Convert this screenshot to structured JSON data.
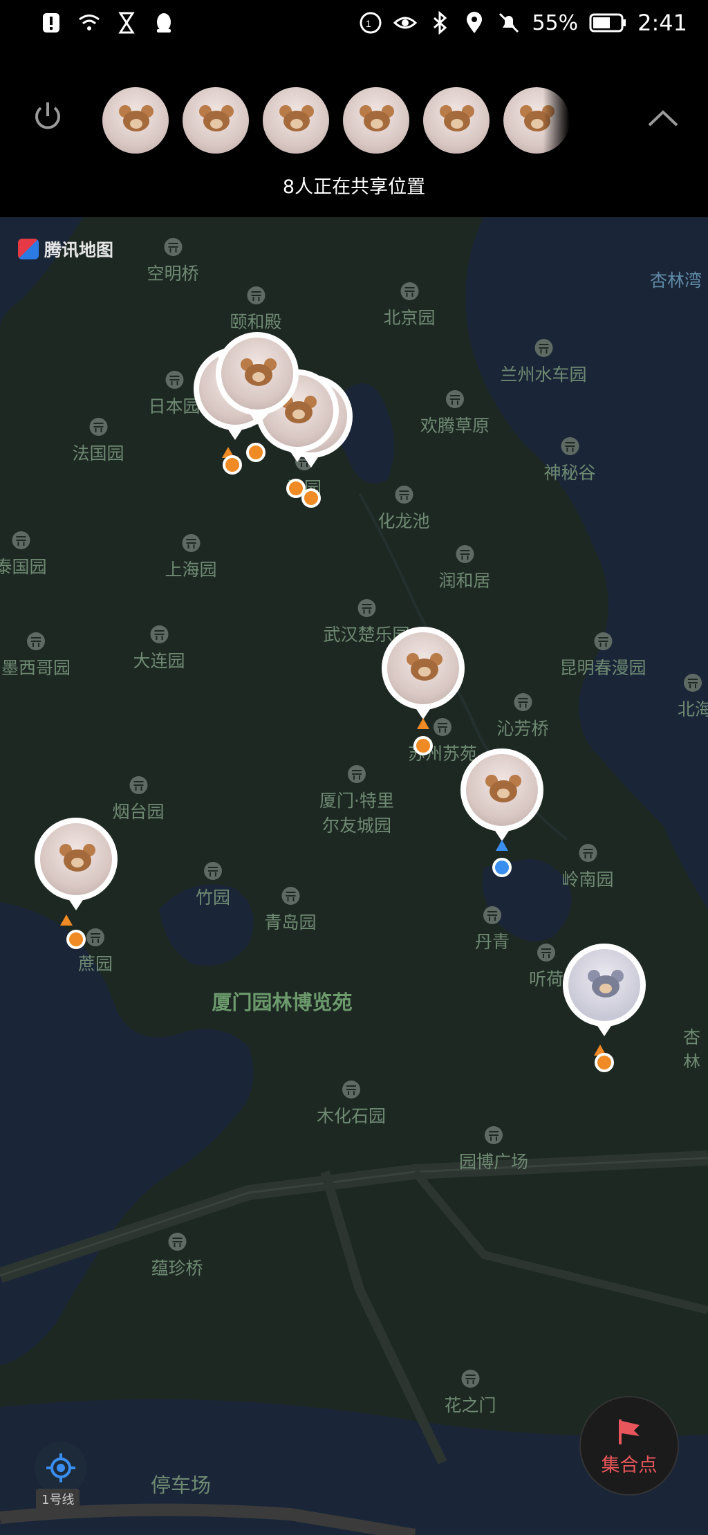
{
  "status_bar": {
    "battery": "55%",
    "time": "2:41"
  },
  "share": {
    "member_count_text": "8人正在共享位置",
    "avatars_count": 6
  },
  "map": {
    "provider": "腾讯地图",
    "area_name": "厦门园林博览苑",
    "pois": [
      {
        "key": "kongmingqiao",
        "label": "空明桥"
      },
      {
        "key": "yiheyuan",
        "label": "颐和殿"
      },
      {
        "key": "beijingyuan",
        "label": "北京园"
      },
      {
        "key": "lanzhou",
        "label": "兰州水车园"
      },
      {
        "key": "ribenyuan",
        "label": "日本园"
      },
      {
        "key": "huanteng",
        "label": "欢腾草原"
      },
      {
        "key": "faguoyuan",
        "label": "法国园"
      },
      {
        "key": "shenmigu",
        "label": "神秘谷"
      },
      {
        "key": "hanyuan",
        "label": "汉园"
      },
      {
        "key": "hualongchi",
        "label": "化龙池"
      },
      {
        "key": "taiguoyuan",
        "label": "泰国园"
      },
      {
        "key": "shanghaiyuan",
        "label": "上海园"
      },
      {
        "key": "runheju",
        "label": "润和居"
      },
      {
        "key": "wuhan",
        "label": "武汉楚乐园"
      },
      {
        "key": "mexico",
        "label": "墨西哥园"
      },
      {
        "key": "dalianyuan",
        "label": "大连园"
      },
      {
        "key": "kunming",
        "label": "昆明春漫园"
      },
      {
        "key": "beihai",
        "label": "北海北海·银滩情"
      },
      {
        "key": "qinfangqiao",
        "label": "沁芳桥"
      },
      {
        "key": "suzhouyuan",
        "label": "苏州苏苑"
      },
      {
        "key": "yantaiyuan",
        "label": "烟台园"
      },
      {
        "key": "xiamen_tl",
        "label": "厦门·特里尔友城园"
      },
      {
        "key": "lingnan",
        "label": "岭南园"
      },
      {
        "key": "zhuyuan",
        "label": "竹园"
      },
      {
        "key": "qingdao",
        "label": "青岛园"
      },
      {
        "key": "danqing",
        "label": "丹青"
      },
      {
        "key": "zheyuan",
        "label": "蔗园"
      },
      {
        "key": "tinghe",
        "label": "听荷"
      },
      {
        "key": "xinglin_sl",
        "label": "杏林水利"
      },
      {
        "key": "muhuashi",
        "label": "木化石园"
      },
      {
        "key": "yuanbo",
        "label": "园博广场"
      },
      {
        "key": "yunzhenqiao",
        "label": "蕴珍桥"
      },
      {
        "key": "huazhimen",
        "label": "花之门"
      }
    ],
    "edge_labels": {
      "xinglinwan": "杏林湾",
      "parking": "停车场"
    },
    "lane_badge": "1号线"
  },
  "controls": {
    "gather_label": "集合点"
  },
  "colors": {
    "map_bg": "#1d2823",
    "water": "#1a2638",
    "accent_orange": "#f08a24",
    "accent_blue": "#3a8ef0",
    "gather_red": "#e9565b"
  }
}
